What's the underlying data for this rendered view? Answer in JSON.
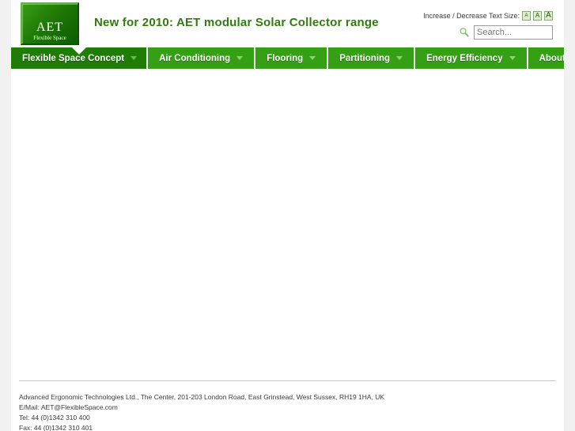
{
  "header": {
    "logo": {
      "title": "AET",
      "subtitle": "Flexible Space"
    },
    "headline": "New for 2010: AET modular Solar Collector range",
    "textsize": {
      "label": "Increase / Decrease Text Size:",
      "buttons": [
        "A",
        "A",
        "A"
      ]
    },
    "search": {
      "icon": "magnifier-icon",
      "value": "",
      "placeholder": "Search..."
    }
  },
  "nav": {
    "items": [
      {
        "label": "Flexible Space Concept",
        "active": true
      },
      {
        "label": "Air Conditioning",
        "active": false
      },
      {
        "label": "Flooring",
        "active": false
      },
      {
        "label": "Partitioning",
        "active": false
      },
      {
        "label": "Energy Efficiency",
        "active": false
      },
      {
        "label": "About Us",
        "active": false
      }
    ]
  },
  "main": {
    "content": ""
  },
  "footer": {
    "address": "Advanced Ergonomic Technologies Ltd., The Center, 201-203 London Road, East Grinstead, West Sussex, RH19 1HA, UK",
    "email": "E/Mail: AET@FlexibleSpace.com",
    "tel": "Tel: 44 (0)1342 310 400",
    "fax": "Fax: 44 (0)1342 310 401"
  },
  "colors": {
    "brand_green": "#2e7d0e",
    "nav_green": "#36a015",
    "nav_active_green": "#1f7c07",
    "page_bg": "#f1f1f1"
  }
}
